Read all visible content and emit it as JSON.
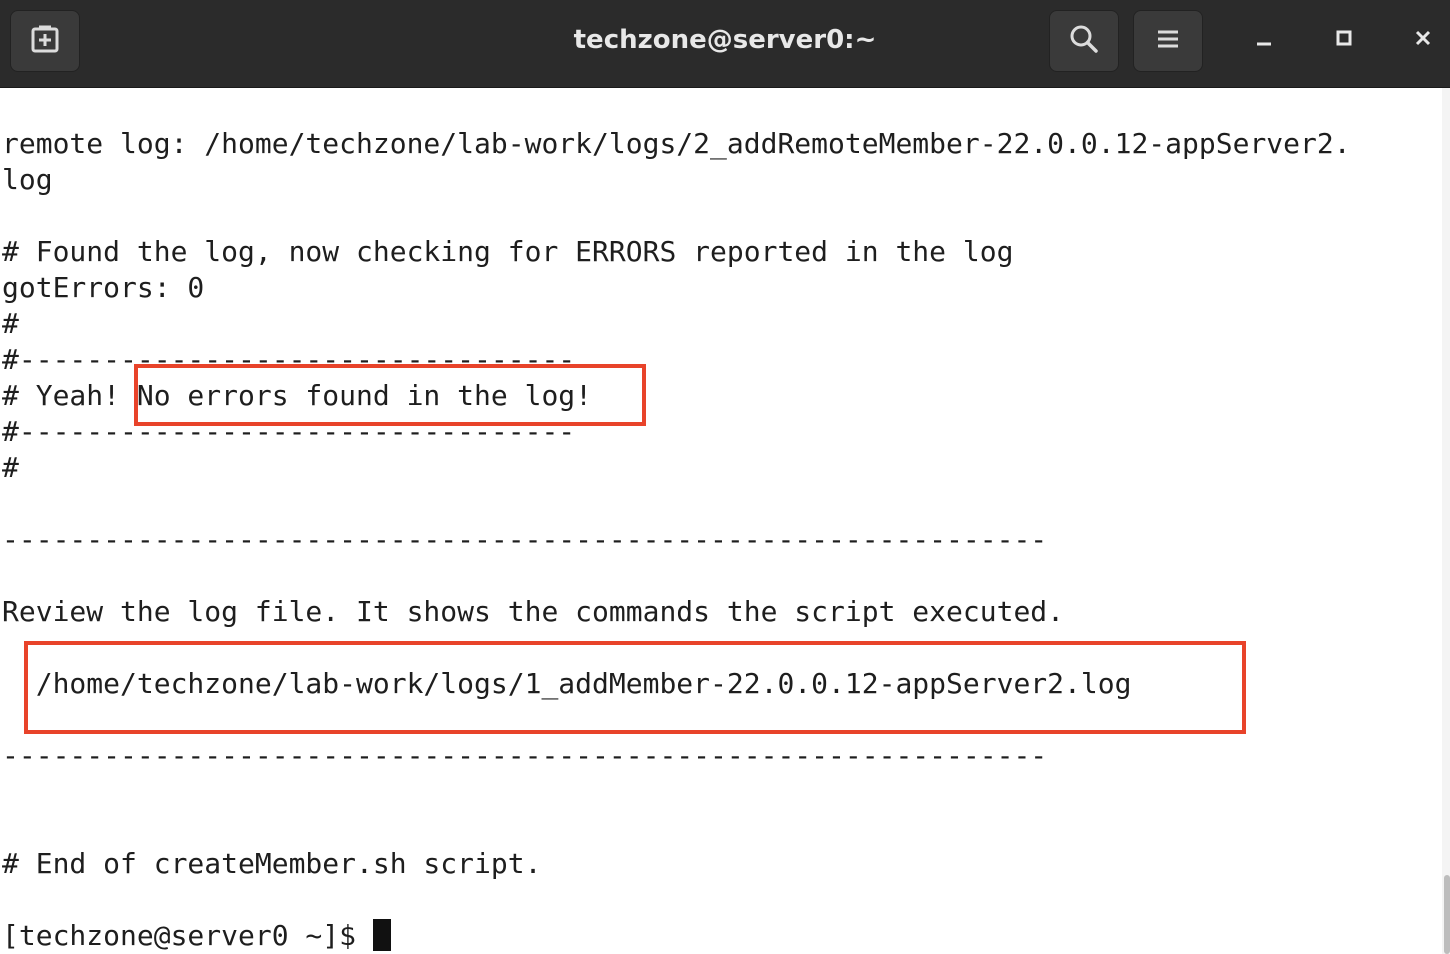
{
  "window": {
    "title": "techzone@server0:~"
  },
  "titlebar_icons": {
    "new_tab": "new-tab-icon",
    "search": "search-icon",
    "menu": "hamburger-menu-icon",
    "minimize": "minimize-icon",
    "maximize": "maximize-icon",
    "close": "close-icon"
  },
  "terminal": {
    "lines": [
      "remote log: /home/techzone/lab-work/logs/2_addRemoteMember-22.0.0.12-appServer2.",
      "log",
      "",
      "# Found the log, now checking for ERRORS reported in the log",
      "gotErrors: 0",
      "#",
      "#---------------------------------",
      "# Yeah! No errors found in the log!",
      "#---------------------------------",
      "#",
      "",
      "--------------------------------------------------------------",
      "",
      "Review the log file. It shows the commands the script executed.",
      "",
      "  /home/techzone/lab-work/logs/1_addMember-22.0.0.12-appServer2.log",
      "",
      "--------------------------------------------------------------",
      "",
      "",
      "# End of createMember.sh script.",
      "",
      "[techzone@server0 ~]$ "
    ]
  },
  "colors": {
    "titlebar_bg": "#2b2b2b",
    "terminal_bg": "#ffffff",
    "terminal_fg": "#1e1e1e",
    "highlight_border": "#e8432a"
  }
}
